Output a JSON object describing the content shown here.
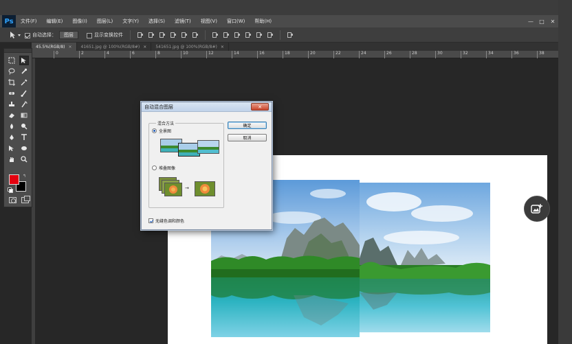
{
  "app": {
    "logo": "Ps",
    "menus": [
      "文件(F)",
      "编辑(E)",
      "图像(I)",
      "图层(L)",
      "文字(Y)",
      "选择(S)",
      "滤镜(T)",
      "视图(V)",
      "窗口(W)",
      "帮助(H)"
    ],
    "window_controls": {
      "minimize": "—",
      "maximize": "□",
      "close": "✕"
    }
  },
  "options_bar": {
    "auto_select_label": "自动选择：",
    "auto_select_value": "图层",
    "show_transform_label": "显示变换控件"
  },
  "tabs": [
    {
      "label": "45.5%(RGB/8)",
      "close": "×"
    },
    {
      "label": "41651.jpg @ 100%(RGB/8#)",
      "close": "×"
    },
    {
      "label": "541651.jpg @ 100%(RGB/8#)",
      "close": "×"
    }
  ],
  "ruler": {
    "labels": [
      "0",
      "2",
      "4",
      "6",
      "8",
      "10",
      "12",
      "14",
      "16",
      "18",
      "20",
      "22",
      "24",
      "26",
      "28",
      "30",
      "32",
      "34",
      "36",
      "38"
    ]
  },
  "dialog": {
    "title": "自动混合图层",
    "close": "✕",
    "group_label": "混合方法",
    "option_panorama": "全景图",
    "option_stack": "堆叠图像",
    "ok_label": "确定",
    "cancel_label": "取消",
    "seamless_label": "无缝色调和颜色",
    "panorama_selected": true,
    "seamless_checked": true
  },
  "colors": {
    "foreground": "#e3000f",
    "background": "#000000",
    "canvas_bg": "#272727"
  }
}
